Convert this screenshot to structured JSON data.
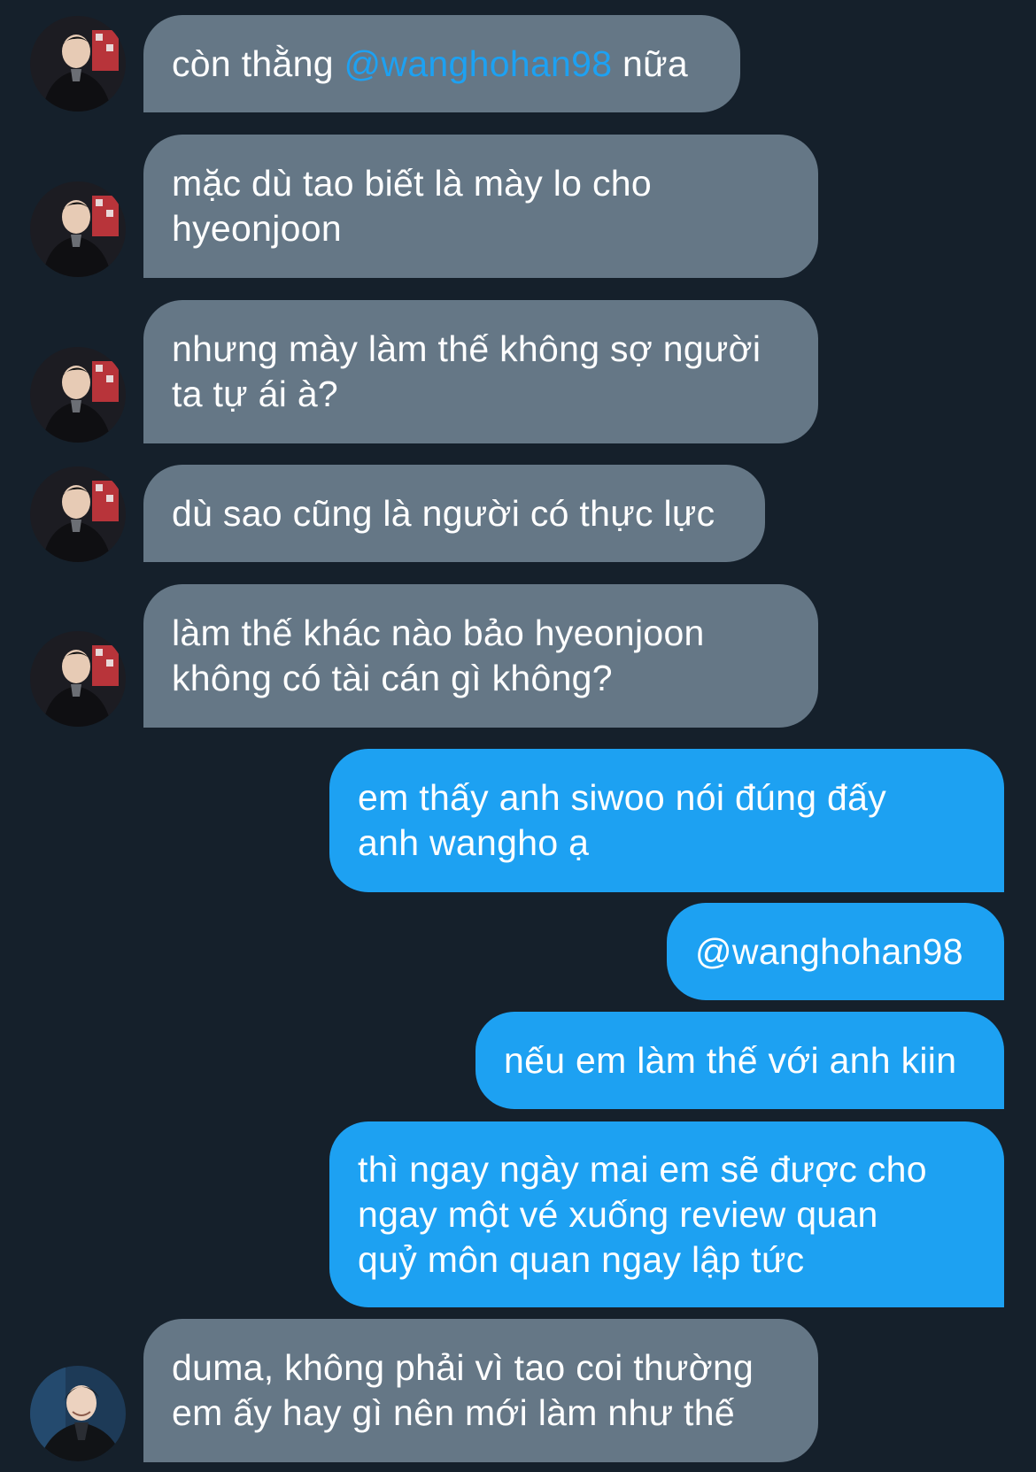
{
  "colors": {
    "background": "#15202b",
    "received_bubble": "#657786",
    "sent_bubble": "#1da1f2",
    "mention": "#1da1f2",
    "text": "#ffffff"
  },
  "messages": [
    {
      "side": "received",
      "avatar": "avatar-1",
      "pre": "còn thằng ",
      "mention": "@wanghohan98",
      "post": " nữa"
    },
    {
      "side": "received",
      "avatar": "avatar-1",
      "text": "mặc dù tao biết là mày lo cho\nhyeonjoon"
    },
    {
      "side": "received",
      "avatar": "avatar-1",
      "text": "nhưng mày làm thế không sợ người\nta tự ái à?"
    },
    {
      "side": "received",
      "avatar": "avatar-1",
      "text": "dù sao cũng là người có thực lực"
    },
    {
      "side": "received",
      "avatar": "avatar-1",
      "text": "làm thế khác nào bảo hyeonjoon\nkhông có tài cán gì không?"
    },
    {
      "side": "sent",
      "text": "em thấy anh siwoo nói đúng đấy\nanh wangho ạ"
    },
    {
      "side": "sent",
      "text": "@wanghohan98"
    },
    {
      "side": "sent",
      "text": "nếu em làm thế với anh kiin"
    },
    {
      "side": "sent",
      "text": "thì ngay ngày mai em sẽ được cho\nngay một vé xuống review quan\nquỷ môn quan ngay lập tức"
    },
    {
      "side": "received",
      "avatar": "avatar-2",
      "text": "duma, không phải vì tao coi thường\nem ấy hay gì nên mới làm như thế"
    }
  ]
}
